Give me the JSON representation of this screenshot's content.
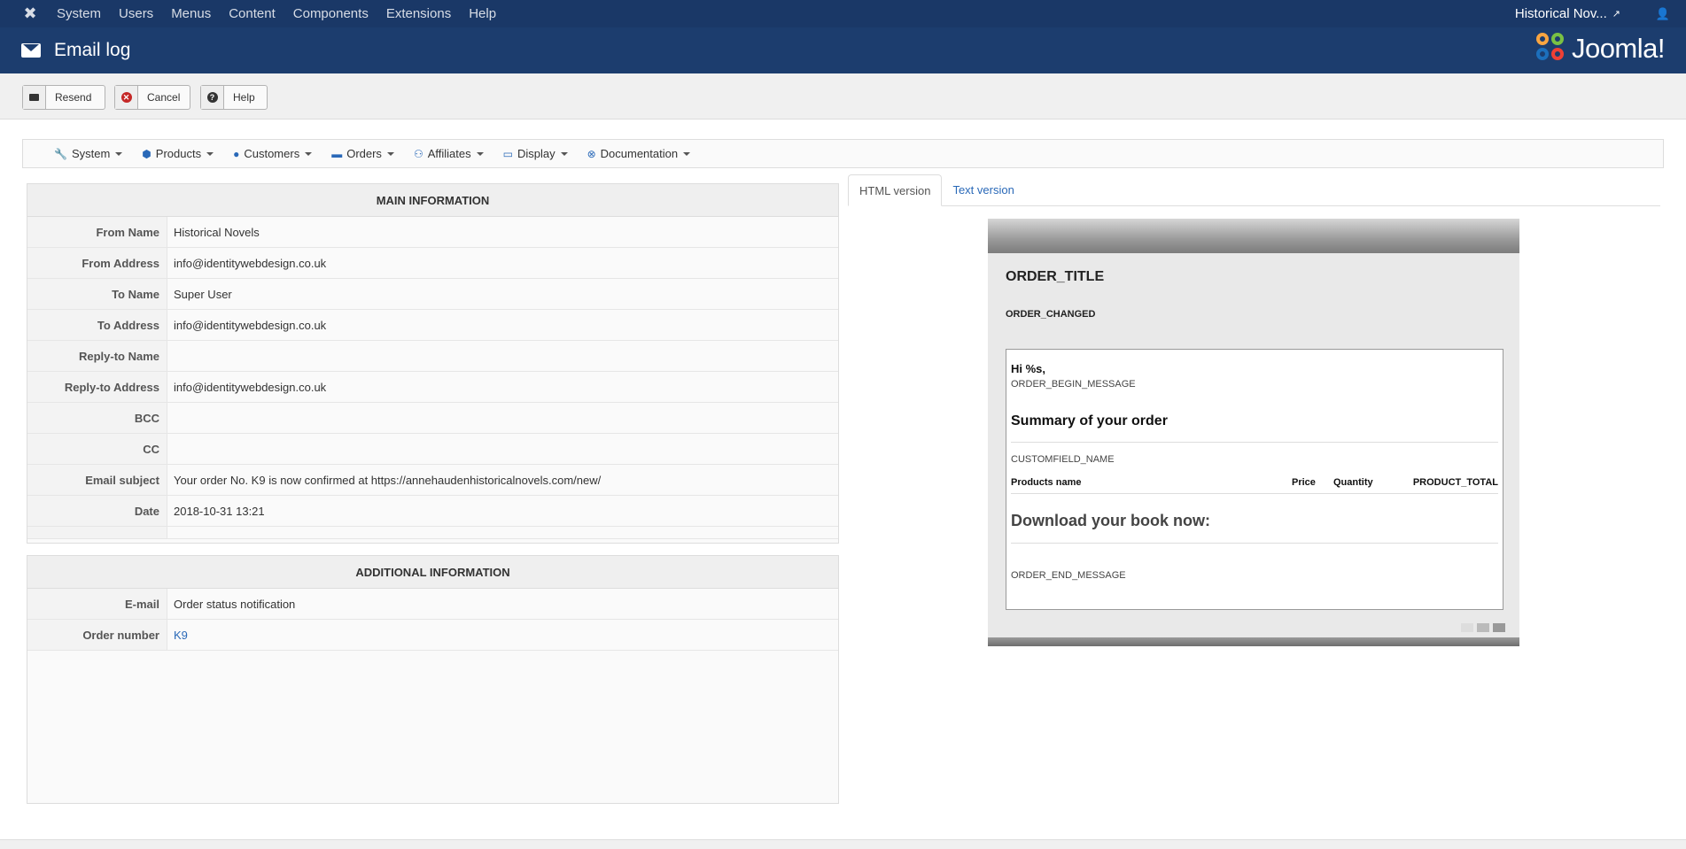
{
  "topbar": {
    "menu": [
      "System",
      "Users",
      "Menus",
      "Content",
      "Components",
      "Extensions",
      "Help"
    ],
    "site_name": "Historical Nov..."
  },
  "header": {
    "title": "Email log",
    "brand": "Joomla!"
  },
  "toolbar": {
    "resend": "Resend",
    "cancel": "Cancel",
    "help": "Help"
  },
  "subnav": [
    {
      "label": "System",
      "icon": "wrench-icon"
    },
    {
      "label": "Products",
      "icon": "cubes-icon"
    },
    {
      "label": "Customers",
      "icon": "user-icon"
    },
    {
      "label": "Orders",
      "icon": "credit-card-icon"
    },
    {
      "label": "Affiliates",
      "icon": "users-icon"
    },
    {
      "label": "Display",
      "icon": "monitor-icon"
    },
    {
      "label": "Documentation",
      "icon": "lifebuoy-icon"
    }
  ],
  "main_info": {
    "heading": "MAIN INFORMATION",
    "rows": [
      {
        "label": "From Name",
        "value": "Historical Novels"
      },
      {
        "label": "From Address",
        "value": "info@identitywebdesign.co.uk"
      },
      {
        "label": "To Name",
        "value": "Super User"
      },
      {
        "label": "To Address",
        "value": "info@identitywebdesign.co.uk"
      },
      {
        "label": "Reply-to Name",
        "value": ""
      },
      {
        "label": "Reply-to Address",
        "value": "info@identitywebdesign.co.uk"
      },
      {
        "label": "BCC",
        "value": ""
      },
      {
        "label": "CC",
        "value": ""
      },
      {
        "label": "Email subject",
        "value": "Your order No. K9 is now confirmed at https://annehaudenhistoricalnovels.com/new/"
      },
      {
        "label": "Date",
        "value": "2018-10-31 13:21"
      }
    ]
  },
  "additional_info": {
    "heading": "ADDITIONAL INFORMATION",
    "rows": [
      {
        "label": "E-mail",
        "value": "Order status notification"
      },
      {
        "label": "Order number",
        "value": "K9"
      }
    ]
  },
  "tabs": {
    "html": "HTML version",
    "text": "Text version"
  },
  "preview": {
    "title": "ORDER_TITLE",
    "changed": "ORDER_CHANGED",
    "greeting": "Hi %s,",
    "begin_message": "ORDER_BEGIN_MESSAGE",
    "summary_heading": "Summary of your order",
    "customfield": "CUSTOMFIELD_NAME",
    "col_product": "Products name",
    "col_price": "Price",
    "col_quantity": "Quantity",
    "col_total": "PRODUCT_TOTAL",
    "download_heading": "Download your book now:",
    "end_message": "ORDER_END_MESSAGE"
  }
}
